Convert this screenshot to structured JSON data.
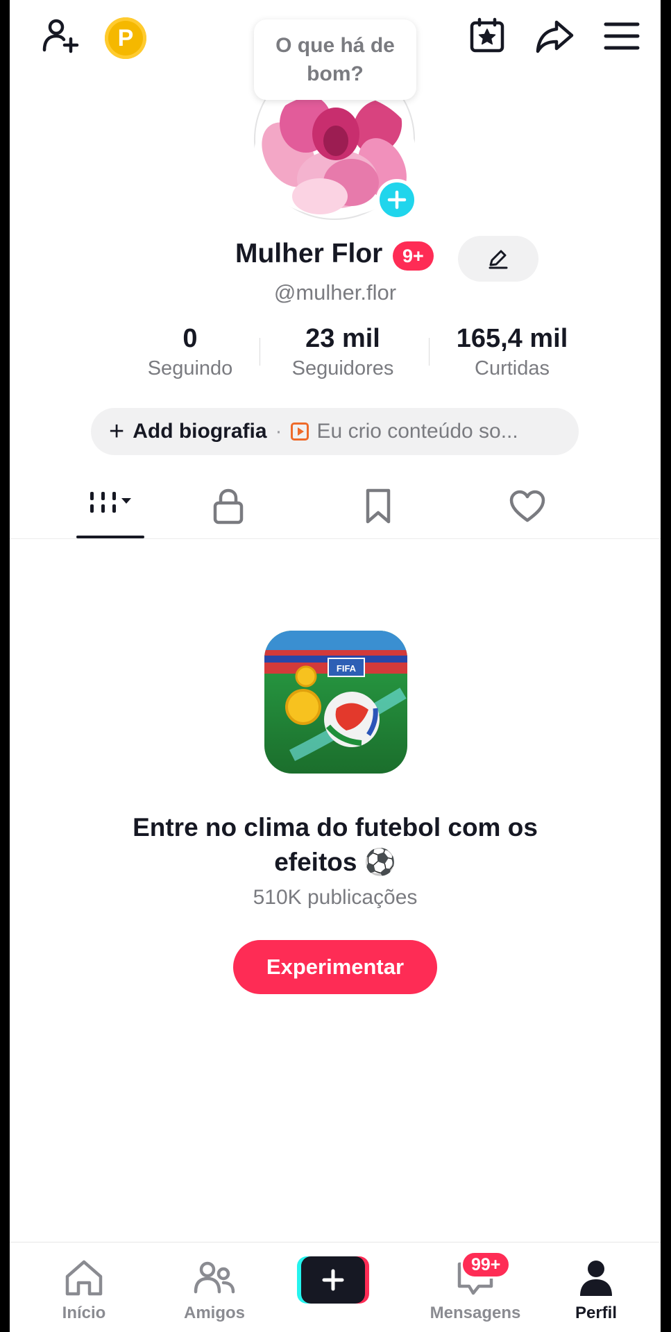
{
  "bubble": {
    "text": "O que há de bom?"
  },
  "profile": {
    "name": "Mulher Flor",
    "name_badge": "9+",
    "handle": "@mulher.flor"
  },
  "stats": [
    {
      "value": "0",
      "label": "Seguindo"
    },
    {
      "value": "23 mil",
      "label": "Seguidores"
    },
    {
      "value": "165,4 mil",
      "label": "Curtidas"
    }
  ],
  "bio": {
    "add_label": "Add biografia",
    "separator": "·",
    "promo_text": "Eu crio conteúdo so..."
  },
  "tabs": [
    {
      "icon": "videos-grid-icon",
      "selected": true
    },
    {
      "icon": "lock-icon",
      "selected": false
    },
    {
      "icon": "bookmark-icon",
      "selected": false
    },
    {
      "icon": "heart-icon",
      "selected": false
    }
  ],
  "promo": {
    "title": "Entre no clima do futebol com os efeitos ⚽",
    "count": "510K publicações",
    "button_label": "Experimentar",
    "image_text": "FIFA"
  },
  "nav": {
    "items": [
      {
        "label": "Início",
        "icon": "home-icon"
      },
      {
        "label": "Amigos",
        "icon": "friends-icon"
      },
      {
        "label": "",
        "icon": "create-icon"
      },
      {
        "label": "Mensagens",
        "icon": "inbox-icon"
      },
      {
        "label": "Perfil",
        "icon": "profile-icon"
      }
    ],
    "messages_badge": "99+"
  },
  "colors": {
    "accent": "#fe2c55",
    "cyan": "#20d5ec",
    "coin": "#f5b800"
  }
}
